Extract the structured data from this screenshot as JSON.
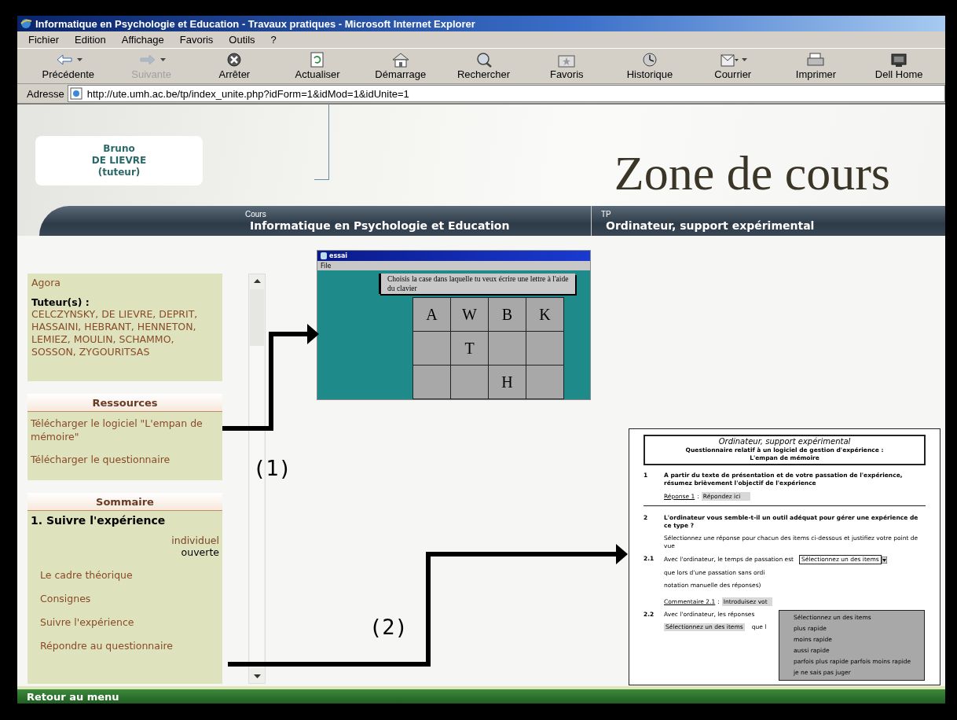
{
  "window": {
    "title": "Informatique en Psychologie et Education - Travaux pratiques - Microsoft Internet Explorer"
  },
  "menu": [
    "Fichier",
    "Edition",
    "Affichage",
    "Favoris",
    "Outils",
    "?"
  ],
  "toolbar": [
    {
      "label": "Précédente",
      "kind": "back",
      "disabled": false,
      "dropdown": true
    },
    {
      "label": "Suivante",
      "kind": "forward",
      "disabled": true,
      "dropdown": true
    },
    {
      "label": "Arrêter",
      "kind": "stop",
      "disabled": false,
      "dropdown": false
    },
    {
      "label": "Actualiser",
      "kind": "refresh",
      "disabled": false,
      "dropdown": false
    },
    {
      "label": "Démarrage",
      "kind": "home",
      "disabled": false,
      "dropdown": false
    },
    {
      "label": "Rechercher",
      "kind": "search",
      "disabled": false,
      "dropdown": false
    },
    {
      "label": "Favoris",
      "kind": "favorites",
      "disabled": false,
      "dropdown": false
    },
    {
      "label": "Historique",
      "kind": "history",
      "disabled": false,
      "dropdown": false
    },
    {
      "label": "Courrier",
      "kind": "mail",
      "disabled": false,
      "dropdown": true
    },
    {
      "label": "Imprimer",
      "kind": "print",
      "disabled": false,
      "dropdown": false
    },
    {
      "label": "Dell Home",
      "kind": "device",
      "disabled": false,
      "dropdown": false
    }
  ],
  "address": {
    "label": "Adresse",
    "url": "http://ute.umh.ac.be/tp/index_unite.php?idForm=1&idMod=1&idUnite=1"
  },
  "user_card": {
    "lines": [
      "Bruno",
      "DE LIEVRE",
      "(tuteur)"
    ]
  },
  "zone_title": "Zone de cours",
  "banner": {
    "course_label": "Cours",
    "course": "Informatique en Psychologie et Education",
    "tp_label": "TP",
    "tp": "Ordinateur, support expérimental"
  },
  "sidebar": {
    "agora": "Agora",
    "tutors_label": "Tuteur(s) :",
    "tutors": "CELCZYNSKY, DE LIEVRE, DEPRIT, HASSAINI, HEBRANT, HENNETON, LEMIEZ, MOULIN, SCHAMMO, SOSSON, ZYGOURITSAS",
    "resources": {
      "title": "Ressources",
      "items": [
        "Télécharger le logiciel \"L'empan de mémoire\"",
        "Télécharger le questionnaire"
      ]
    },
    "summary": {
      "title": "Sommaire",
      "heading": "1. Suivre l'expérience",
      "mode": "individuel",
      "status": "ouverte",
      "items": [
        "Le cadre théorique",
        "Consignes",
        "Suivre l'expérience",
        "Répondre au questionnaire"
      ]
    }
  },
  "app_window": {
    "title": "essai",
    "menu": "File",
    "instruction": "Choisis la case dans laquelle tu veux écrire une lettre à l'aide du clavier",
    "cells": [
      {
        "letter": "A"
      },
      {
        "letter": "W"
      },
      {
        "letter": "B"
      },
      {
        "letter": "K"
      },
      {},
      {
        "letter": "T"
      },
      {},
      {},
      {},
      {},
      {
        "letter": "H"
      },
      {}
    ]
  },
  "document": {
    "title": "Ordinateur, support expérimental",
    "subtitle": "Questionnaire relatif à un logiciel de gestion d'expérience :",
    "subtitle_2": "L'empan de mémoire",
    "q1": {
      "number": "1",
      "text": "A partir du texte de présentation et de votre passation de l'expérience, résumez brièvement l'objectif de l'expérience",
      "answer_label": "Réponse 1",
      "answer_separator": ":",
      "answer_placeholder": "Répondez ici"
    },
    "q2": {
      "number": "2",
      "text": "L'ordinateur vous semble-t-il un outil adéquat pour gérer une expérience de ce type ?",
      "instruction": "Sélectionnez une réponse pour chacun des items ci-dessous et justifiez votre point de vue"
    },
    "q21": {
      "number": "2.1",
      "text": "Avec l'ordinateur, le temps de passation est",
      "select": "Sélectionnez un des items",
      "text_2": "que lors d'une passation sans ordi",
      "text_3": "notation manuelle des réponses)",
      "comment_label": "Commentaire 2.1",
      "comment_separator": ":",
      "comment_placeholder": "Introduisez vot"
    },
    "q22": {
      "number": "2.2",
      "text": "Avec l'ordinateur, les réponses",
      "select": "Sélectionnez un des items",
      "text_2": "que l"
    },
    "dropdown_options": [
      "Sélectionnez un des items",
      "plus rapide",
      "moins rapide",
      "aussi rapide",
      "parfois plus rapide parfois moins rapide",
      "je ne sais pas juger"
    ]
  },
  "annotations": [
    {
      "label": "(1)"
    },
    {
      "label": "(2)"
    }
  ],
  "footer": "Retour au menu"
}
